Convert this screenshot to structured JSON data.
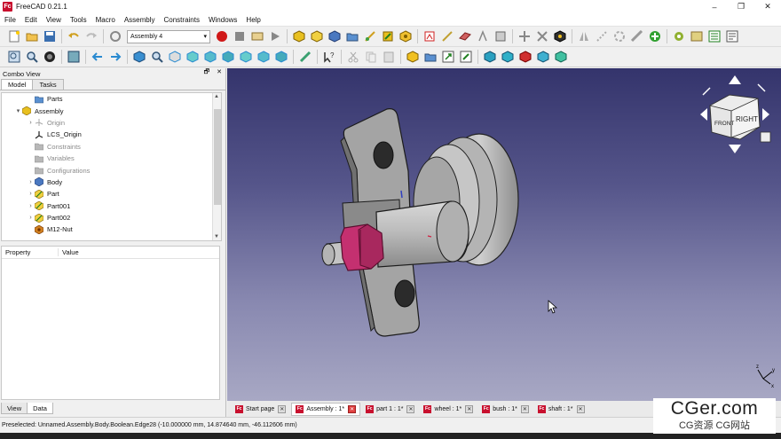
{
  "window": {
    "title": "FreeCAD 0.21.1",
    "logo": "Fc",
    "minimize_icon": "–",
    "restore_icon": "❐",
    "close_icon": "✕"
  },
  "menu": [
    "File",
    "Edit",
    "View",
    "Tools",
    "Macro",
    "Assembly",
    "Constraints",
    "Windows",
    "Help"
  ],
  "toolbar": {
    "workbench_selector": "Assembly 4",
    "workbench_caret": "▾"
  },
  "combo_view": {
    "title": "Combo View",
    "float_icon": "🗗",
    "close_icon": "✕",
    "tabs": [
      "Model",
      "Tasks"
    ],
    "tree": [
      {
        "label": "Parts",
        "indent": 2,
        "expander": "",
        "icon": "folder",
        "grayed": false
      },
      {
        "label": "Assembly",
        "indent": 1,
        "expander": "▾",
        "icon": "assembly",
        "grayed": false
      },
      {
        "label": "Origin",
        "indent": 2,
        "expander": "›",
        "icon": "origin",
        "grayed": true
      },
      {
        "label": "LCS_Origin",
        "indent": 2,
        "expander": "",
        "icon": "lcs",
        "grayed": false
      },
      {
        "label": "Constraints",
        "indent": 2,
        "expander": "",
        "icon": "folder-gray",
        "grayed": true
      },
      {
        "label": "Variables",
        "indent": 2,
        "expander": "",
        "icon": "folder-gray",
        "grayed": true
      },
      {
        "label": "Configurations",
        "indent": 2,
        "expander": "",
        "icon": "folder-gray",
        "grayed": true
      },
      {
        "label": "Body",
        "indent": 2,
        "expander": "›",
        "icon": "body",
        "grayed": false
      },
      {
        "label": "Part",
        "indent": 2,
        "expander": "›",
        "icon": "part",
        "grayed": false
      },
      {
        "label": "Part001",
        "indent": 2,
        "expander": "›",
        "icon": "part",
        "grayed": false
      },
      {
        "label": "Part002",
        "indent": 2,
        "expander": "›",
        "icon": "part",
        "grayed": false
      },
      {
        "label": "M12-Nut",
        "indent": 2,
        "expander": "",
        "icon": "nut",
        "grayed": false
      }
    ],
    "property_headers": [
      "Property",
      "Value"
    ],
    "bottom_tabs": [
      "View",
      "Data"
    ]
  },
  "navcube": {
    "faces": [
      "FRONT",
      "RIGHT"
    ]
  },
  "document_tabs": [
    {
      "label": "Start page",
      "active": false
    },
    {
      "label": "Assembly : 1*",
      "active": true
    },
    {
      "label": "part 1 : 1*",
      "active": false
    },
    {
      "label": "wheel : 1*",
      "active": false
    },
    {
      "label": "bush : 1*",
      "active": false
    },
    {
      "label": "shaft : 1*",
      "active": false
    }
  ],
  "status_text": "Preselected: Unnamed.Assembly.Body.Boolean.Edge28 (-10.000000 mm, 14.874640 mm, -46.112606 mm)",
  "watermark": {
    "main": "CGer.com",
    "sub": "CG资源  CG网站"
  },
  "axis_labels": {
    "x": "x",
    "y": "y",
    "z": "z"
  },
  "colors": {
    "nut": "#c43070",
    "part_gray": "#a8a8a8",
    "bg_top": "#34346c",
    "bg_bottom": "#a8a8c4"
  }
}
